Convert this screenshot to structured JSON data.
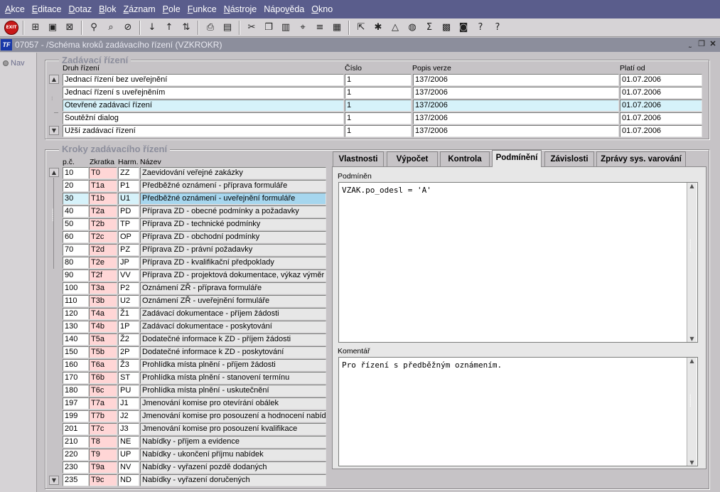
{
  "menu": [
    "Akce",
    "Editace",
    "Dotaz",
    "Blok",
    "Záznam",
    "Pole",
    "Funkce",
    "Nástroje",
    "Nápověda",
    "Okno"
  ],
  "menu_underline": [
    "A",
    "E",
    "D",
    "B",
    "Z",
    "P",
    "F",
    "N",
    "v",
    "O"
  ],
  "toolbar_icons": [
    "exit-icon",
    "insert-icon",
    "save-icon",
    "clear-icon",
    "find-icon",
    "query-icon",
    "cancel-query-icon",
    "sort-asc-icon",
    "sort-desc-icon",
    "sort-multi-icon",
    "print-icon",
    "print-preview-icon",
    "cut-icon",
    "copy-icon",
    "paste-icon",
    "search-replace-icon",
    "indent-icon",
    "columns-icon",
    "export-icon",
    "tools-icon",
    "chart-icon",
    "disk-icon",
    "sum-icon",
    "excel-icon",
    "calendar-icon",
    "help-context-icon",
    "help-icon"
  ],
  "window": {
    "title": "07057 - /Schéma kroků zadávacího řízení (VZKROKR)",
    "app_icon": "TF"
  },
  "nav": {
    "label": "Nav"
  },
  "zadavaci": {
    "title": "Zadávací řízení",
    "headers": {
      "druh": "Druh řízení",
      "cislo": "Číslo",
      "popis": "Popis verze",
      "plati": "Platí od"
    },
    "rows": [
      {
        "druh": "Jednací řízení bez uveřejnění",
        "cislo": "1",
        "popis": "137/2006",
        "plati": "01.07.2006",
        "selected": false
      },
      {
        "druh": "Jednací řízení s uveřejněním",
        "cislo": "1",
        "popis": "137/2006",
        "plati": "01.07.2006",
        "selected": false
      },
      {
        "druh": "Otevřené zadávací řízení",
        "cislo": "1",
        "popis": "137/2006",
        "plati": "01.07.2006",
        "selected": true
      },
      {
        "druh": "Soutěžní dialog",
        "cislo": "1",
        "popis": "137/2006",
        "plati": "01.07.2006",
        "selected": false
      },
      {
        "druh": "Užší zadávací řízení",
        "cislo": "1",
        "popis": "137/2006",
        "plati": "01.07.2006",
        "selected": false
      }
    ]
  },
  "kroky": {
    "title": "Kroky zadávacího řízení",
    "headers": {
      "pc": "p.č.",
      "zkratka": "Zkratka",
      "harm": "Harm.",
      "nazev": "Název"
    },
    "rows": [
      {
        "pc": "10",
        "zkratka": "T0",
        "harm": "ZZ",
        "nazev": "Zaevidování veřejné zakázky",
        "selected": false
      },
      {
        "pc": "20",
        "zkratka": "T1a",
        "harm": "P1",
        "nazev": "Předběžné oznámení - příprava formuláře",
        "selected": false
      },
      {
        "pc": "30",
        "zkratka": "T1b",
        "harm": "U1",
        "nazev": "Předběžné oznámení - uveřejnění formuláře",
        "selected": true
      },
      {
        "pc": "40",
        "zkratka": "T2a",
        "harm": "PD",
        "nazev": "Příprava ZD - obecné podmínky a požadavky",
        "selected": false
      },
      {
        "pc": "50",
        "zkratka": "T2b",
        "harm": "TP",
        "nazev": "Příprava ZD - technické podmínky",
        "selected": false
      },
      {
        "pc": "60",
        "zkratka": "T2c",
        "harm": "OP",
        "nazev": "Příprava ZD - obchodní podmínky",
        "selected": false
      },
      {
        "pc": "70",
        "zkratka": "T2d",
        "harm": "PZ",
        "nazev": "Příprava ZD - právní požadavky",
        "selected": false
      },
      {
        "pc": "80",
        "zkratka": "T2e",
        "harm": "JP",
        "nazev": "Příprava ZD - kvalifikační předpoklady",
        "selected": false
      },
      {
        "pc": "90",
        "zkratka": "T2f",
        "harm": "VV",
        "nazev": "Příprava ZD - projektová dokumentace, výkaz výměr",
        "selected": false
      },
      {
        "pc": "100",
        "zkratka": "T3a",
        "harm": "P2",
        "nazev": "Oznámení ZŘ - příprava formuláře",
        "selected": false
      },
      {
        "pc": "110",
        "zkratka": "T3b",
        "harm": "U2",
        "nazev": "Oznámení ZŘ - uveřejnění formuláře",
        "selected": false
      },
      {
        "pc": "120",
        "zkratka": "T4a",
        "harm": "Ž1",
        "nazev": "Zadávací dokumentace - příjem žádosti",
        "selected": false
      },
      {
        "pc": "130",
        "zkratka": "T4b",
        "harm": "1P",
        "nazev": "Zadávací dokumentace - poskytování",
        "selected": false
      },
      {
        "pc": "140",
        "zkratka": "T5a",
        "harm": "Ž2",
        "nazev": "Dodatečné informace k ZD - příjem žádosti",
        "selected": false
      },
      {
        "pc": "150",
        "zkratka": "T5b",
        "harm": "2P",
        "nazev": "Dodatečné informace k ZD - poskytování",
        "selected": false
      },
      {
        "pc": "160",
        "zkratka": "T6a",
        "harm": "Ž3",
        "nazev": "Prohlídka místa plnění - příjem žádosti",
        "selected": false
      },
      {
        "pc": "170",
        "zkratka": "T6b",
        "harm": "ST",
        "nazev": "Prohlídka místa plnění - stanovení termínu",
        "selected": false
      },
      {
        "pc": "180",
        "zkratka": "T6c",
        "harm": "PU",
        "nazev": "Prohlídka místa plnění - uskutečnění",
        "selected": false
      },
      {
        "pc": "197",
        "zkratka": "T7a",
        "harm": "J1",
        "nazev": "Jmenování komise pro otevírání obálek",
        "selected": false
      },
      {
        "pc": "199",
        "zkratka": "T7b",
        "harm": "J2",
        "nazev": "Jmenování komise pro posouzení a hodnocení nabídek",
        "selected": false
      },
      {
        "pc": "201",
        "zkratka": "T7c",
        "harm": "J3",
        "nazev": "Jmenování komise pro posouzení kvalifikace",
        "selected": false
      },
      {
        "pc": "210",
        "zkratka": "T8",
        "harm": "NE",
        "nazev": "Nabídky - příjem a evidence",
        "selected": false
      },
      {
        "pc": "220",
        "zkratka": "T9",
        "harm": "UP",
        "nazev": "Nabídky - ukončení příjmu nabídek",
        "selected": false
      },
      {
        "pc": "230",
        "zkratka": "T9a",
        "harm": "NV",
        "nazev": "Nabídky - vyřazení pozdě dodaných",
        "selected": false
      },
      {
        "pc": "235",
        "zkratka": "T9c",
        "harm": "ND",
        "nazev": "Nabídky - vyřazení doručených",
        "selected": false
      }
    ]
  },
  "tabs": [
    {
      "label": "Vlastnosti",
      "active": false
    },
    {
      "label": "Výpočet",
      "active": false
    },
    {
      "label": "Kontrola",
      "active": false
    },
    {
      "label": "Podmínění",
      "active": true
    },
    {
      "label": "Závislosti",
      "active": false
    },
    {
      "label": "Zprávy sys. varování",
      "active": false
    }
  ],
  "podmineni": {
    "label": "Podmíněn",
    "value": "VZAK.po_odesl = 'A'",
    "komentar_label": "Komentář",
    "komentar_value": "Pro řízení s předběžným oznámením."
  },
  "colors": {
    "menubar": "#5a5d8c",
    "pink_cell": "#ffd6d6",
    "selected_row": "#d6f2fa",
    "selected_name": "#a6d6ee",
    "frame_title": "#8c8e9c"
  }
}
